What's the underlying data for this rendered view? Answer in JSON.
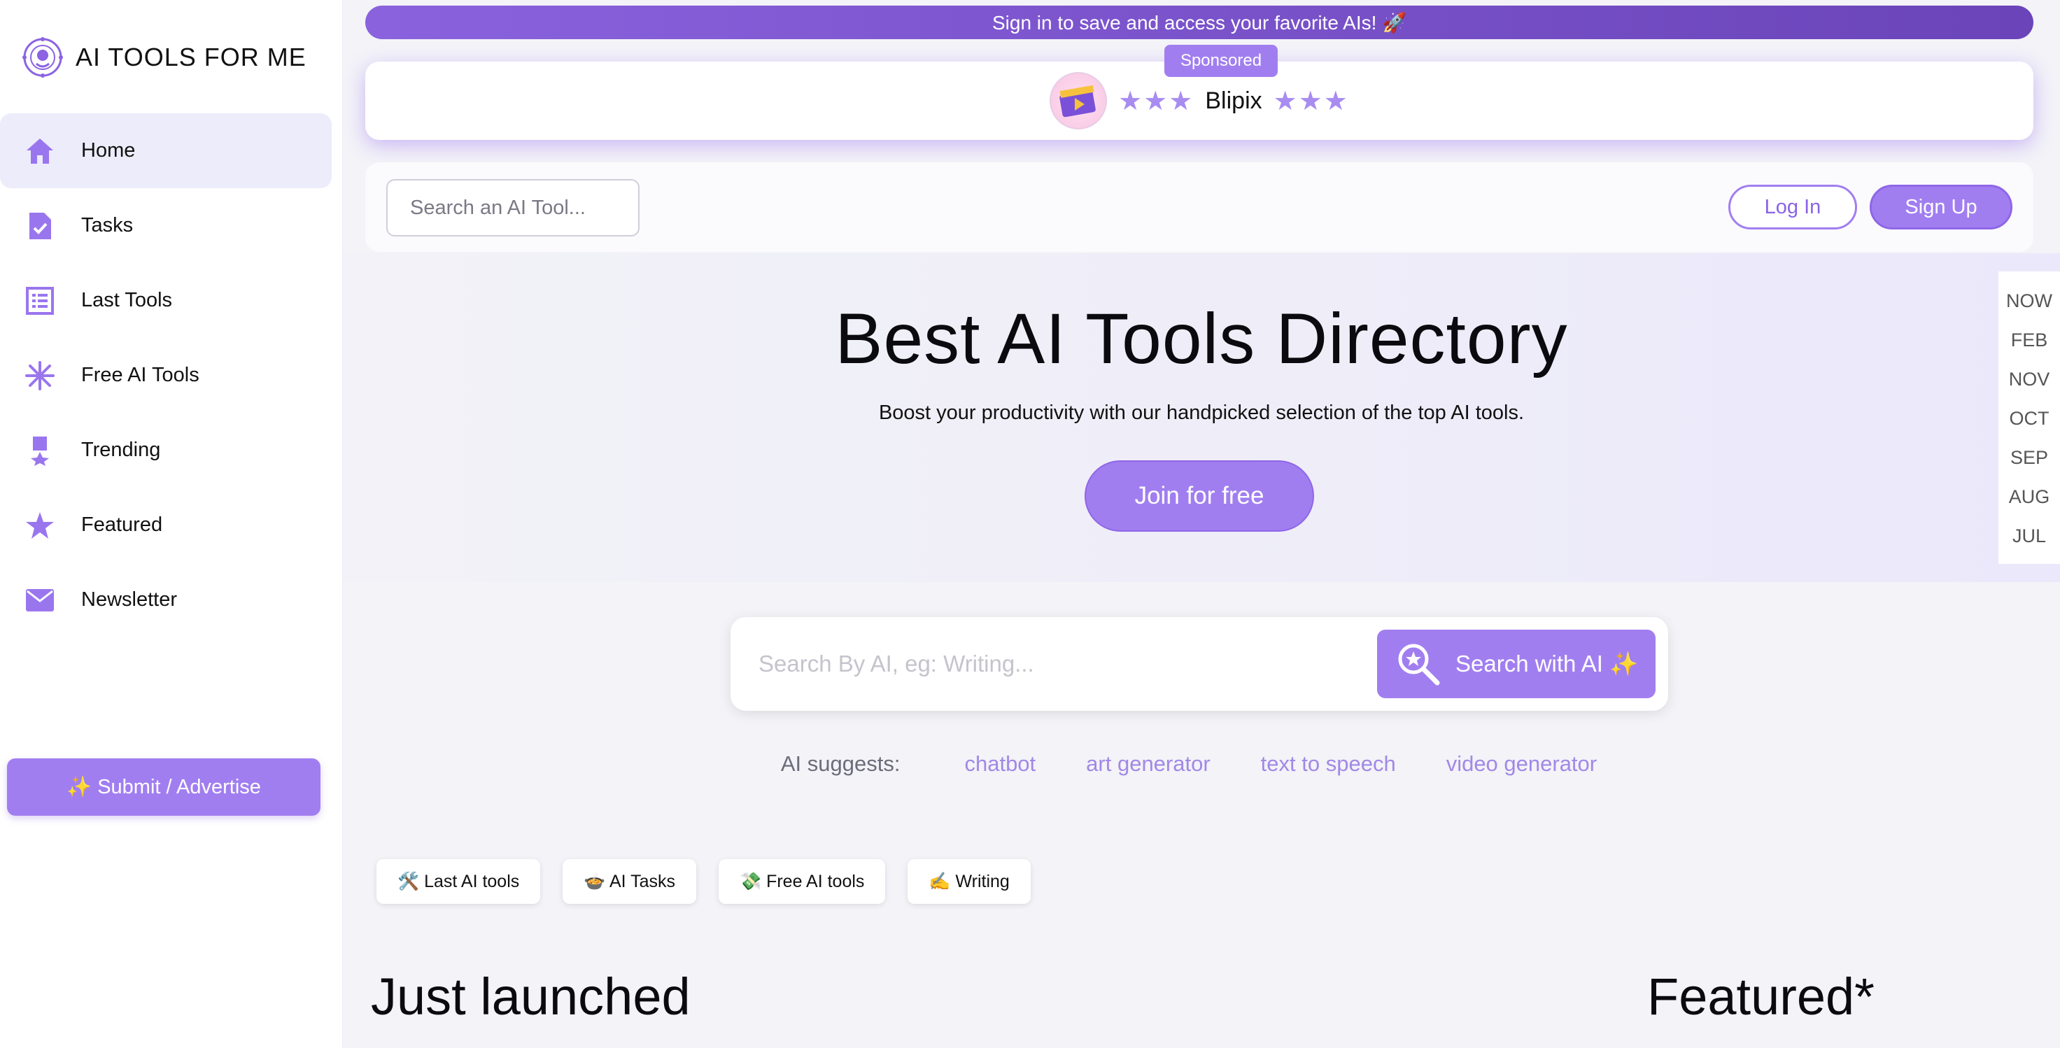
{
  "brand": {
    "name": "AI TOOLS FOR ME"
  },
  "sidebar": {
    "items": [
      {
        "label": "Home",
        "icon": "home-icon",
        "active": true
      },
      {
        "label": "Tasks",
        "icon": "task-doc-icon",
        "active": false
      },
      {
        "label": "Last Tools",
        "icon": "list-icon",
        "active": false
      },
      {
        "label": "Free AI Tools",
        "icon": "snowflake-icon",
        "active": false
      },
      {
        "label": "Trending",
        "icon": "medal-icon",
        "active": false
      },
      {
        "label": "Featured",
        "icon": "star-icon",
        "active": false
      },
      {
        "label": "Newsletter",
        "icon": "mail-icon",
        "active": false
      }
    ],
    "submit_label": "✨ Submit / Advertise"
  },
  "banner": {
    "text": "Sign in to save and access your favorite AIs! 🚀"
  },
  "sponsor": {
    "tag": "Sponsored",
    "stars_left": "★★★",
    "name": "Blipix",
    "stars_right": "★★★"
  },
  "header": {
    "search_placeholder": "Search an AI Tool...",
    "login_label": "Log In",
    "signup_label": "Sign Up"
  },
  "hero": {
    "title": "Best AI Tools Directory",
    "subtitle": "Boost your productivity with our handpicked selection of the top AI tools.",
    "cta_label": "Join for free"
  },
  "timeline": [
    "NOW",
    "FEB",
    "NOV",
    "OCT",
    "SEP",
    "AUG",
    "JUL"
  ],
  "ai_search": {
    "placeholder": "Search By AI, eg: Writing...",
    "button_label": "Search with AI ✨"
  },
  "suggestions": {
    "label": "AI suggests:",
    "items": [
      "chatbot",
      "art generator",
      "text to speech",
      "video generator"
    ]
  },
  "chips": [
    "🛠️ Last AI tools",
    "🍲 AI Tasks",
    "💸 Free AI tools",
    "✍️ Writing"
  ],
  "sections": {
    "just_launched": "Just launched",
    "featured": "Featured*"
  },
  "colors": {
    "accent": "#a17ef0",
    "accent_dark": "#6a44b8",
    "link": "#a288e6"
  }
}
